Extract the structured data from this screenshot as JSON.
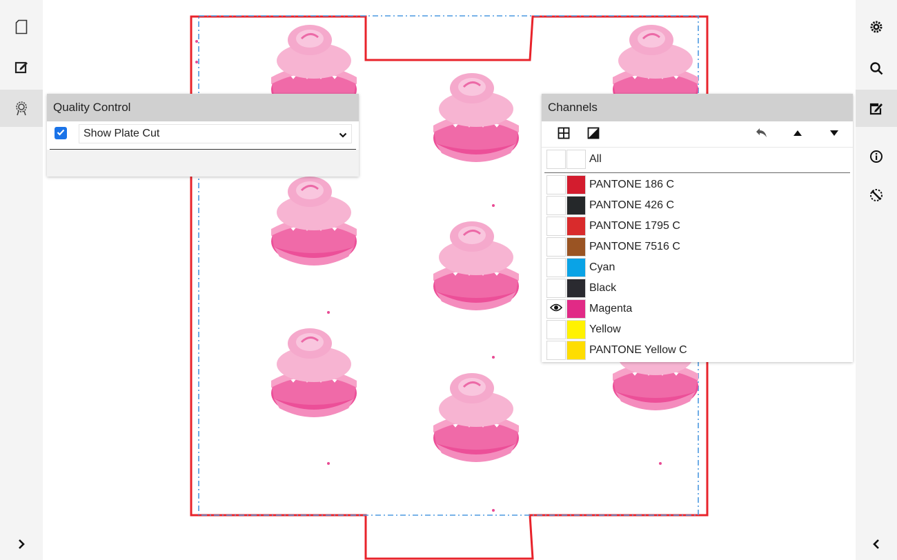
{
  "left_toolbar": {
    "items": [
      {
        "icon": "document-icon",
        "active": false
      },
      {
        "icon": "edit-icon",
        "active": false
      },
      {
        "icon": "quality-badge-icon",
        "active": true
      }
    ],
    "expand_icon": "chevron-right-icon"
  },
  "right_toolbar": {
    "items": [
      {
        "icon": "gear-icon",
        "active": false
      },
      {
        "icon": "search-icon",
        "active": false
      },
      {
        "icon": "pen-edit-icon",
        "active": true
      },
      {
        "icon": "info-icon",
        "active": false
      },
      {
        "icon": "measure-icon",
        "active": false
      }
    ],
    "collapse_icon": "chevron-left-icon"
  },
  "quality_control": {
    "title": "Quality Control",
    "show_plate_cut_checked": true,
    "selected_option": "Show Plate Cut"
  },
  "channels": {
    "title": "Channels",
    "toolbar_icons": [
      "grid-view-icon",
      "contrast-icon",
      "undo-icon",
      "move-up-icon",
      "move-down-icon"
    ],
    "all_label": "All",
    "items": [
      {
        "name": "PANTONE 186 C",
        "color": "#d31c2e",
        "visible": false
      },
      {
        "name": "PANTONE 426 C",
        "color": "#25282a",
        "visible": false
      },
      {
        "name": "PANTONE 1795 C",
        "color": "#d92b2c",
        "visible": false
      },
      {
        "name": "PANTONE 7516 C",
        "color": "#9a5423",
        "visible": false
      },
      {
        "name": "Cyan",
        "color": "#0aa3e6",
        "visible": false
      },
      {
        "name": "Black",
        "color": "#2a2a30",
        "visible": false
      },
      {
        "name": "Magenta",
        "color": "#e12a86",
        "visible": true
      },
      {
        "name": "Yellow",
        "color": "#fff200",
        "visible": false
      },
      {
        "name": "PANTONE Yellow C",
        "color": "#fedd00",
        "visible": false
      }
    ]
  },
  "artwork": {
    "die_line_color": "#e8232b",
    "bleed_line_color": "#4a98e0",
    "separation_color": "#e84a93"
  }
}
